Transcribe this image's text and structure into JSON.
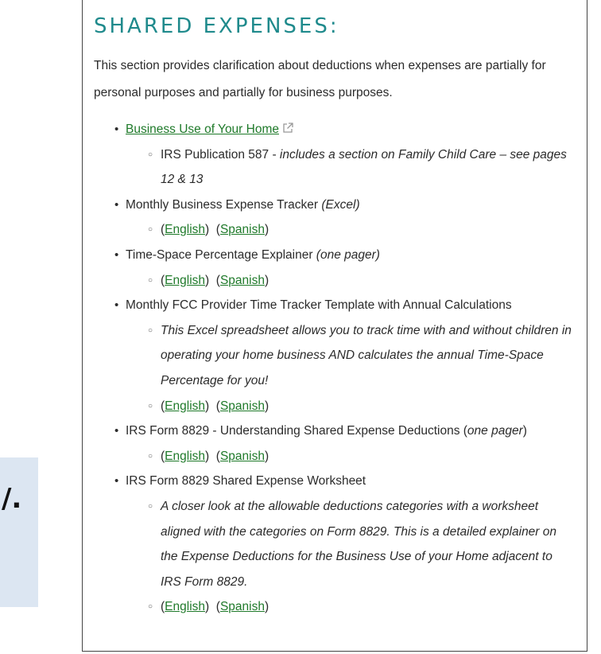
{
  "side_box": {
    "glyph": "/."
  },
  "section": {
    "title": "SHARED EXPENSES:",
    "intro": "This section provides clarification about deductions when expenses are partially for personal purposes and partially for business purposes."
  },
  "items": [
    {
      "link_text": "Business Use of Your Home",
      "sub": {
        "prefix": "IRS Publication 587 - ",
        "italic": "includes a section on Family Child Care – see pages 12 & 13"
      }
    },
    {
      "text": "Monthly Business Expense Tracker ",
      "italic": "(Excel)",
      "links": {
        "english": "English",
        "spanish": "Spanish"
      }
    },
    {
      "text": "Time-Space Percentage Explainer ",
      "italic": "(one pager)",
      "links": {
        "english": "English",
        "spanish": "Spanish"
      }
    },
    {
      "text": "Monthly FCC Provider Time Tracker Template with Annual Calculations",
      "description": "This Excel spreadsheet allows you to track time with and without children in operating your home business AND calculates the annual Time-Space Percentage for you!",
      "links": {
        "english": "English",
        "spanish": "Spanish"
      }
    },
    {
      "text": "IRS Form 8829 - Understanding Shared Expense Deductions (",
      "italic": "one pager",
      "text_end": ")",
      "links": {
        "english": "English",
        "spanish": "Spanish"
      }
    },
    {
      "text": "IRS Form 8829 Shared Expense Worksheet",
      "description": "A closer look at the allowable deductions categories with a worksheet aligned with the categories on Form 8829. This is a detailed explainer on the Expense Deductions for the Business Use of your Home adjacent to IRS Form 8829.",
      "links": {
        "english": "English",
        "spanish": "Spanish"
      }
    }
  ]
}
